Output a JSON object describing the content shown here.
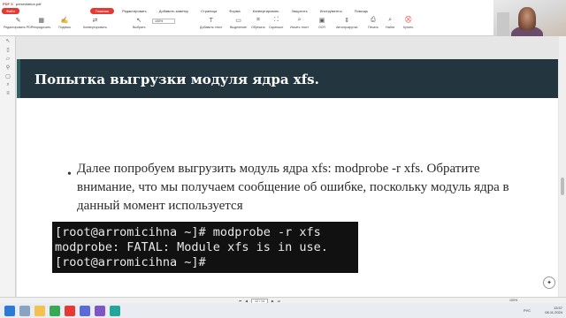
{
  "window": {
    "app_name": "PDF X",
    "file_name": "presentation.pdf"
  },
  "menu": {
    "file_label": "Файл",
    "items": [
      "Главная",
      "Редактировать",
      "Добавить заметку",
      "Страница",
      "Форма",
      "Конвертировать",
      "Защитить",
      "Инструменты",
      "Помощь"
    ],
    "active_index": 0
  },
  "toolbar": {
    "tools": [
      "Редактировать PDF",
      "Упорядочить",
      "Подпись",
      "Конвертировать",
      "Выбрать",
      "Добавить текст",
      "Выделение",
      "Обрезать",
      "Скриншот",
      "Искать текст",
      "OCR",
      "Автопрокрутка",
      "Печать",
      "Найти",
      "Купить"
    ],
    "zoom": "100%"
  },
  "sidebar": {
    "icons": [
      "cursor-icon",
      "bookmark-icon",
      "comment-icon",
      "attachment-icon",
      "page-icon",
      "search-icon",
      "layers-icon"
    ]
  },
  "slide": {
    "title": "Попытка выгрузки модуля ядра xfs.",
    "bullet": "Далее попробуем выгрузить модуль ядра xfs: modprobe -r xfs. Обратите внимание, что мы получаем сообщение об ошибке, поскольку модуль ядра в данный момент используется",
    "terminal": [
      "[root@arromicihna ~]# modprobe -r xfs",
      "modprobe: FATAL: Module xfs is in use.",
      "[root@arromicihna ~]#"
    ]
  },
  "status": {
    "page": "12 / 14",
    "zoom": "100%"
  },
  "taskbar": {
    "lang": "РУС",
    "time": "13:57",
    "date": "08.11.2024"
  },
  "colors": {
    "accent": "#e53935",
    "slide_header": "#23363f",
    "terminal_bg": "#111111"
  }
}
